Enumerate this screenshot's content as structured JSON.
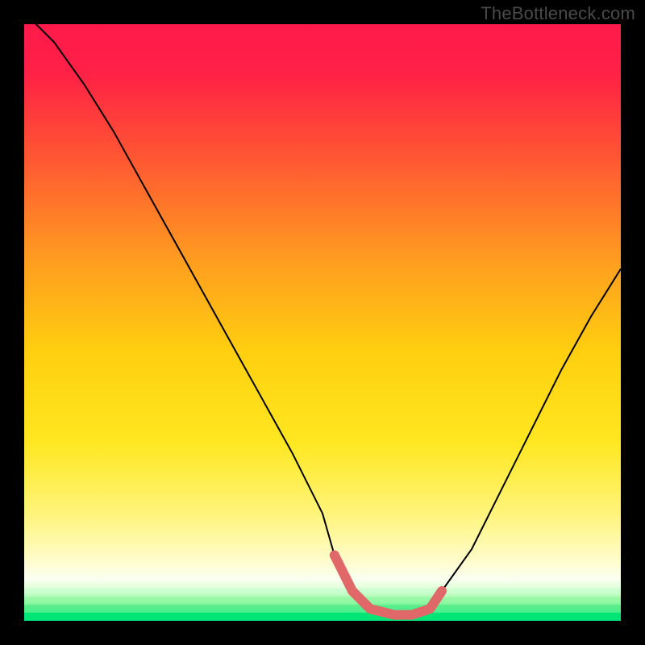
{
  "watermark": "TheBottleneck.com",
  "colors": {
    "bg_black": "#000000",
    "gradient_top": "#ff1744",
    "gradient_upper_mid": "#ff5030",
    "gradient_mid": "#ffc107",
    "gradient_lower_mid": "#ffeb3b",
    "gradient_pale": "#fffde7",
    "gradient_bottom": "#00e676",
    "curve": "#000000",
    "highlight": "#e57373",
    "watermark_text": "#4a4a4a"
  },
  "chart_data": {
    "type": "line",
    "title": "",
    "xlabel": "",
    "ylabel": "",
    "xlim": [
      0,
      100
    ],
    "ylim": [
      0,
      100
    ],
    "series": [
      {
        "name": "bottleneck-curve",
        "x": [
          0,
          5,
          10,
          15,
          20,
          25,
          30,
          35,
          40,
          45,
          50,
          52,
          55,
          58,
          62,
          65,
          68,
          70,
          75,
          80,
          85,
          90,
          95,
          100
        ],
        "y": [
          102,
          97,
          90,
          82,
          73,
          64,
          55,
          46,
          37,
          28,
          18,
          11,
          5,
          2,
          1,
          1,
          2,
          5,
          12,
          22,
          32,
          42,
          51,
          59
        ]
      }
    ],
    "highlight_range_x": [
      52,
      70
    ],
    "annotations": []
  }
}
